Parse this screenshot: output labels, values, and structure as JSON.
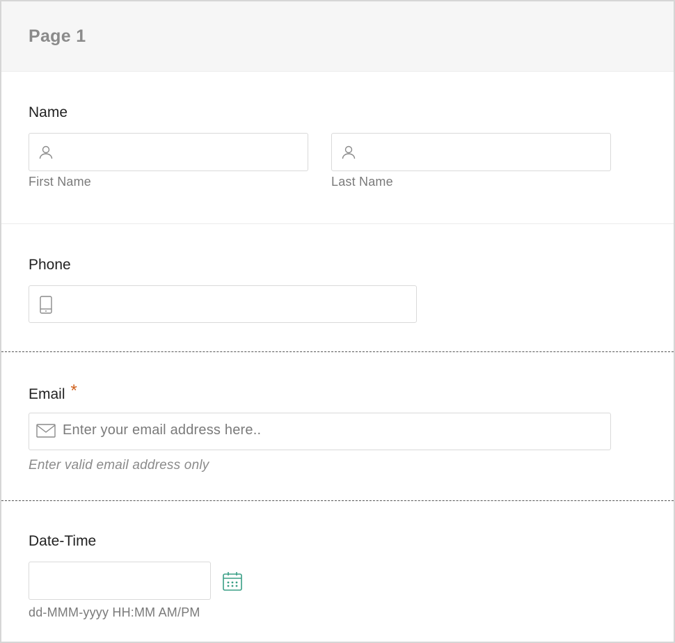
{
  "page": {
    "title": "Page 1"
  },
  "name_field": {
    "label": "Name",
    "first": {
      "sublabel": "First Name",
      "value": ""
    },
    "last": {
      "sublabel": "Last Name",
      "value": ""
    }
  },
  "phone_field": {
    "label": "Phone",
    "value": ""
  },
  "email_field": {
    "label": "Email",
    "required_mark": "*",
    "placeholder": "Enter your email address here..",
    "hint": "Enter valid email address only"
  },
  "datetime_field": {
    "label": "Date-Time",
    "format_hint": "dd-MMM-yyyy HH:MM AM/PM",
    "value": ""
  },
  "colors": {
    "required": "#d0601c",
    "calendar_icon": "#3a9f86",
    "header_bg": "#f6f6f6"
  },
  "icons": [
    "user-icon",
    "mobile-phone-icon",
    "envelope-icon",
    "calendar-icon"
  ]
}
